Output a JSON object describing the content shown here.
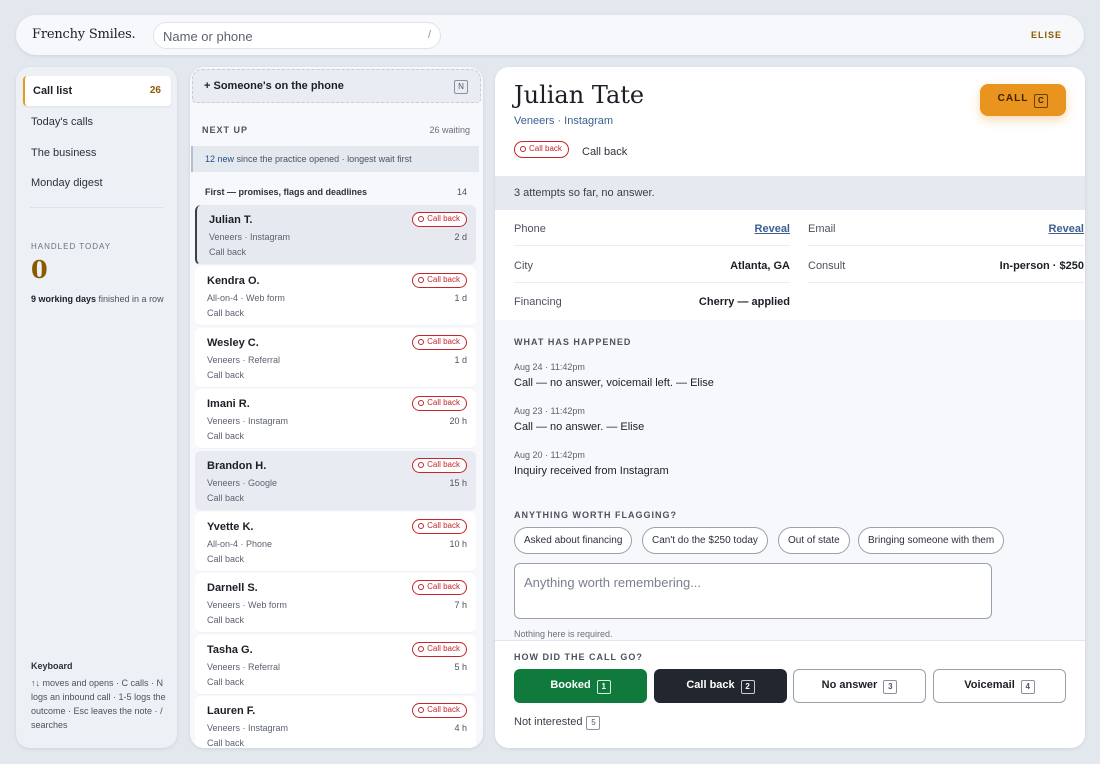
{
  "header": {
    "brand": "Frenchy Smiles.",
    "search_placeholder": "Name or phone",
    "search_shortcut": "/",
    "user": "ELISE"
  },
  "sidebar": {
    "items": [
      {
        "label": "Call list",
        "count": "26"
      },
      {
        "label": "Today's calls"
      },
      {
        "label": "The business"
      },
      {
        "label": "Monday digest"
      }
    ],
    "handled_label": "HANDLED TODAY",
    "handled_value": "0",
    "streak_bold": "9 working days",
    "streak_rest": " finished in a row",
    "keyboard_title": "Keyboard",
    "keyboard_text": "↑↓ moves and opens · C calls · N logs an inbound call · 1-5 logs the outcome · Esc leaves the note · / searches"
  },
  "queue": {
    "phone_label": "+ Someone's on the phone",
    "phone_key": "N",
    "next_up": "NEXT UP",
    "waiting": "26 waiting",
    "new_count": "12 new",
    "new_text": " since the practice opened · longest wait first",
    "section_title": "First — promises, flags and deadlines",
    "section_count": "14",
    "items": [
      {
        "name": "Julian T.",
        "meta": "Veneers · Instagram",
        "status": "Call back",
        "time": "2 d",
        "pill": "Call back"
      },
      {
        "name": "Kendra O.",
        "meta": "All-on-4 · Web form",
        "status": "Call back",
        "time": "1 d",
        "pill": "Call back"
      },
      {
        "name": "Wesley C.",
        "meta": "Veneers · Referral",
        "status": "Call back",
        "time": "1 d",
        "pill": "Call back"
      },
      {
        "name": "Imani R.",
        "meta": "Veneers · Instagram",
        "status": "Call back",
        "time": "20 h",
        "pill": "Call back"
      },
      {
        "name": "Brandon H.",
        "meta": "Veneers · Google",
        "status": "Call back",
        "time": "15 h",
        "pill": "Call back"
      },
      {
        "name": "Yvette K.",
        "meta": "All-on-4 · Phone",
        "status": "Call back",
        "time": "10 h",
        "pill": "Call back"
      },
      {
        "name": "Darnell S.",
        "meta": "Veneers · Web form",
        "status": "Call back",
        "time": "7 h",
        "pill": "Call back"
      },
      {
        "name": "Tasha G.",
        "meta": "Veneers · Referral",
        "status": "Call back",
        "time": "5 h",
        "pill": "Call back"
      },
      {
        "name": "Lauren F.",
        "meta": "Veneers · Instagram",
        "status": "Call back",
        "time": "4 h",
        "pill": "Call back"
      }
    ]
  },
  "detail": {
    "name": "Julian Tate",
    "subtitle": "Veneers · Instagram",
    "status_pill": "Call back",
    "status_text": "Call back",
    "call_label": "CALL",
    "call_key": "C",
    "attempts": "3 attempts so far, no answer.",
    "fields": {
      "phone_label": "Phone",
      "phone_action": "Reveal",
      "email_label": "Email",
      "email_action": "Reveal",
      "city_label": "City",
      "city_value": "Atlanta, GA",
      "consult_label": "Consult",
      "consult_value": "In-person · $250",
      "financing_label": "Financing",
      "financing_value": "Cherry — applied"
    },
    "history_title": "WHAT HAS HAPPENED",
    "history": [
      {
        "date": "Aug 24 · 11:42pm",
        "text": "Call — no answer, voicemail left. — Elise"
      },
      {
        "date": "Aug 23 · 11:42pm",
        "text": "Call — no answer. — Elise"
      },
      {
        "date": "Aug 20 · 11:42pm",
        "text": "Inquiry received from Instagram"
      }
    ],
    "flags_title": "ANYTHING WORTH FLAGGING?",
    "flags": [
      "Asked about financing",
      "Can't do the $250 today",
      "Out of state",
      "Bringing someone with them"
    ],
    "note_placeholder": "Anything worth remembering...",
    "note_hint": "Nothing here is required.",
    "outcome_title": "HOW DID THE CALL GO?",
    "outcomes": [
      {
        "label": "Booked",
        "key": "1"
      },
      {
        "label": "Call back",
        "key": "2"
      },
      {
        "label": "No answer",
        "key": "3"
      },
      {
        "label": "Voicemail",
        "key": "4"
      }
    ],
    "not_interested": {
      "label": "Not interested",
      "key": "5"
    }
  }
}
